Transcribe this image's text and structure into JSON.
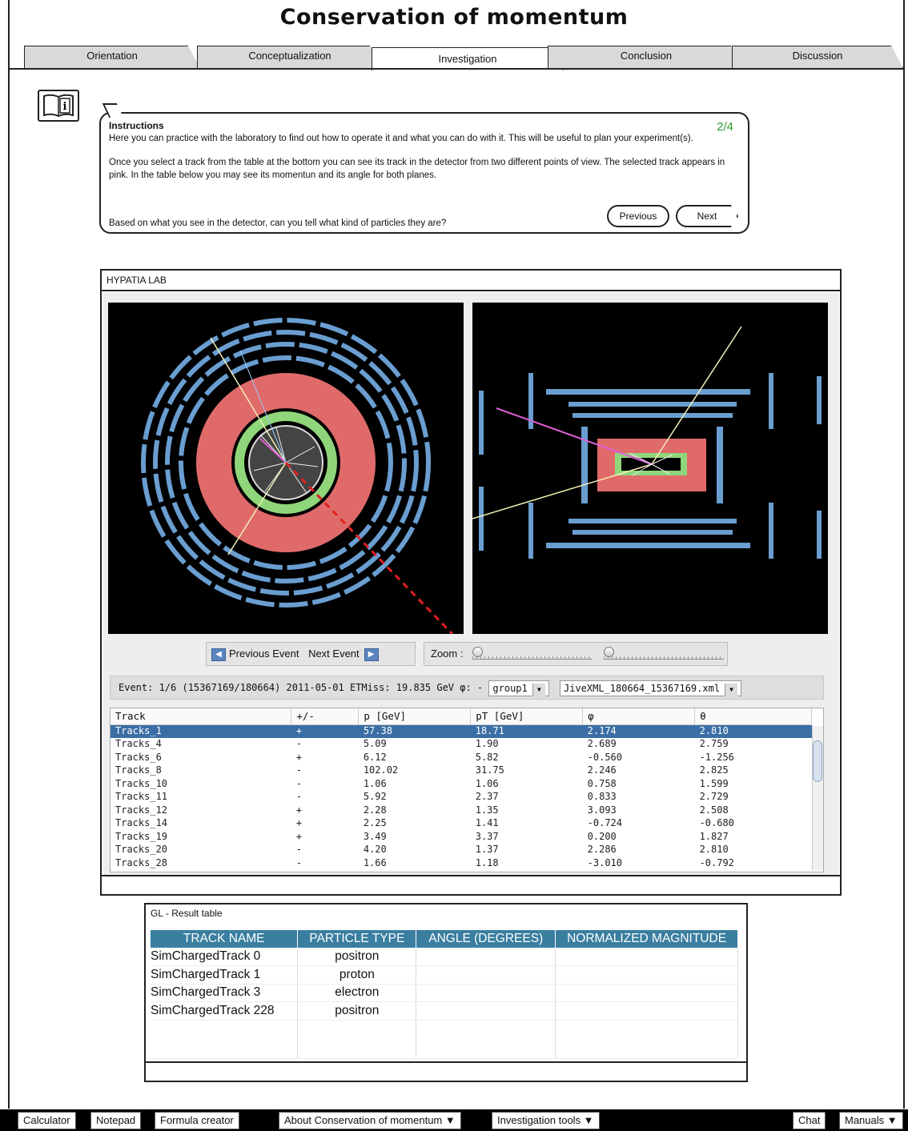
{
  "app": {
    "title": "Conservation of momentum"
  },
  "tabs": [
    {
      "label": "Orientation",
      "active": false
    },
    {
      "label": "Conceptualization",
      "active": false
    },
    {
      "label": "Investigation",
      "active": true
    },
    {
      "label": "Conclusion",
      "active": false
    },
    {
      "label": "Discussion",
      "active": false
    }
  ],
  "instructions": {
    "heading": "Instructions",
    "step": "2/4",
    "p1": "Here you can practice with the laboratory to find out how to operate it and what you can do with it. This will be useful to plan your experiment(s).",
    "p2": "Once you select a track from the table at the bottom you can see its track in the detector from two different points of view. The selected track appears in pink. In the table below you may see its momentun and its angle for both planes.",
    "p3": "Based on what you see in the detector, can you tell what kind of particles they are?",
    "previous": "Previous",
    "next": "Next"
  },
  "lab": {
    "title": "HYPATIA LAB",
    "prev_event": "Previous Event",
    "next_event": "Next Event",
    "zoom_label": "Zoom :",
    "event_info": "Event: 1/6 (15367169/180664)  2011-05-01  ETMiss: 19.835 GeV  φ: -",
    "group_select": "group1",
    "file_select": "JiveXML_180664_15367169.xml",
    "columns": [
      "Track",
      "+/-",
      "p [GeV]",
      "pT [GeV]",
      "φ",
      "θ"
    ],
    "rows": [
      [
        "Tracks_1",
        "+",
        "57.38",
        "18.71",
        "2.174",
        "2.810"
      ],
      [
        "Tracks_4",
        "-",
        "5.09",
        "1.90",
        "2.689",
        "2.759"
      ],
      [
        "Tracks_6",
        "+",
        "6.12",
        "5.82",
        "-0.560",
        "-1.256"
      ],
      [
        "Tracks_8",
        "-",
        "102.02",
        "31.75",
        "2.246",
        "2.825"
      ],
      [
        "Tracks_10",
        "-",
        "1.06",
        "1.06",
        "0.758",
        "1.599"
      ],
      [
        "Tracks_11",
        "-",
        "5.92",
        "2.37",
        "0.833",
        "2.729"
      ],
      [
        "Tracks_12",
        "+",
        "2.28",
        "1.35",
        "3.093",
        "2.508"
      ],
      [
        "Tracks_14",
        "+",
        "2.25",
        "1.41",
        "-0.724",
        "-0.680"
      ],
      [
        "Tracks_19",
        "+",
        "3.49",
        "3.37",
        "0.200",
        "1.827"
      ],
      [
        "Tracks_20",
        "-",
        "4.20",
        "1.37",
        "2.286",
        "2.810"
      ],
      [
        "Tracks_28",
        "-",
        "1.66",
        "1.18",
        "-3.010",
        "-0.792"
      ]
    ]
  },
  "result": {
    "title": "GL - Result table",
    "columns": [
      "TRACK NAME",
      "PARTICLE TYPE",
      "ANGLE (DEGREES)",
      "NORMALIZED MAGNITUDE"
    ],
    "rows": [
      [
        "SimChargedTrack 0",
        "positron",
        "",
        ""
      ],
      [
        "SimChargedTrack 1",
        "proton",
        "",
        ""
      ],
      [
        "SimChargedTrack 3",
        "electron",
        "",
        ""
      ],
      [
        "SimChargedTrack 228",
        "positron",
        "",
        ""
      ]
    ]
  },
  "bottom_bar": {
    "calculator": "Calculator",
    "notepad": "Notepad",
    "formula": "Formula creator",
    "about": "About Conservation of momentum ▼",
    "tools": "Investigation tools ▼",
    "chat": "Chat",
    "manuals": "Manuals ▼"
  },
  "colors": {
    "accent": "#3a7ea0",
    "selection": "#3b6ea5",
    "step": "#2ea02e"
  }
}
